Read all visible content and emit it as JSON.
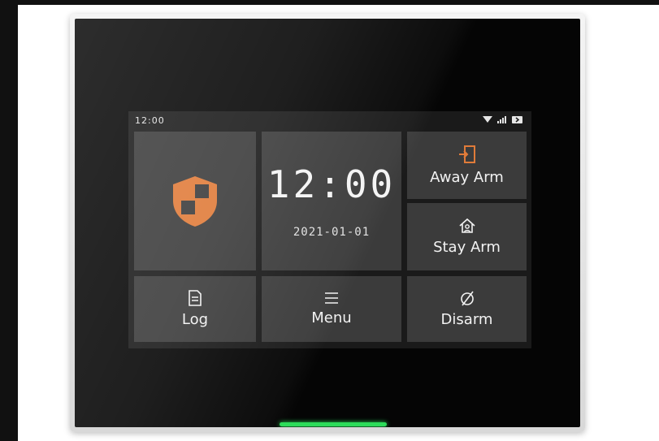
{
  "status_bar": {
    "time": "12:00",
    "icons": [
      "wifi-icon",
      "signal-icon",
      "battery-icon"
    ]
  },
  "tiles": {
    "security": {
      "icon": "shield-icon"
    },
    "clock": {
      "time": "12:00",
      "date": "2021-01-01"
    },
    "away_arm": {
      "icon": "door-exit-icon",
      "label": "Away Arm"
    },
    "stay_arm": {
      "icon": "home-user-icon",
      "label": "Stay Arm"
    },
    "log": {
      "icon": "document-icon",
      "label": "Log"
    },
    "menu": {
      "icon": "menu-icon",
      "label": "Menu"
    },
    "disarm": {
      "icon": "disarm-icon",
      "label": "Disarm"
    }
  },
  "colors": {
    "accent": "#e07b39",
    "tile": "#3b3b3b",
    "led": "#2ddc5a"
  }
}
